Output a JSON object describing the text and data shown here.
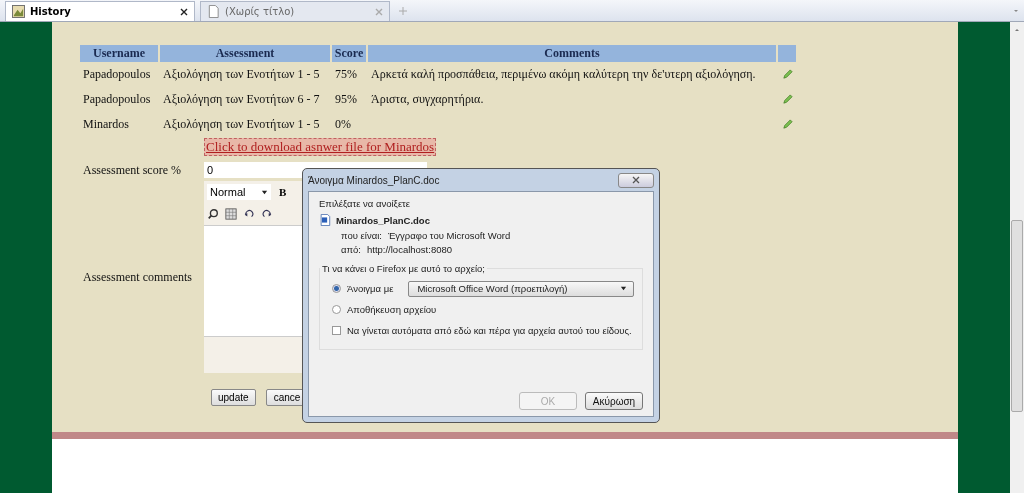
{
  "tabs": [
    {
      "label": "History",
      "selected": true,
      "kind": "history"
    },
    {
      "label": "(Χωρίς τίτλο)",
      "selected": false,
      "kind": "page"
    }
  ],
  "table": {
    "columns": [
      "Username",
      "Assessment",
      "Score",
      "Comments"
    ],
    "rows": [
      {
        "username": "Papadopoulos",
        "assessment": "Αξιολόγηση των Ενοτήτων 1 - 5",
        "score": "75%",
        "comments": "Αρκετά καλή προσπάθεια, περιμένω ακόμη καλύτερη την δε'υτερη αξιολόγηση."
      },
      {
        "username": "Papadopoulos",
        "assessment": "Αξιολόγηση των Ενοτήτων 6 - 7",
        "score": "95%",
        "comments": "Άριστα, συγχαρητήρια."
      },
      {
        "username": "Minardos",
        "assessment": "Αξιολόγηση των Ενοτήτων 1 - 5",
        "score": "0%"
      }
    ]
  },
  "download_link": "Click to download asnwer file for Minardos",
  "form": {
    "score_label": "Assessment score %",
    "score_value": "0",
    "comments_label": "Assessment comments",
    "editor": {
      "format": "Normal",
      "bold": "B"
    },
    "buttons": [
      {
        "label": "update"
      },
      {
        "label": "cance"
      }
    ]
  },
  "dialog": {
    "title": "Άνοιγμα Minardos_PlanC.doc",
    "prompt": "Επιλέξατε να ανοίξετε",
    "filename": "Minardos_PlanC.doc",
    "type_label": "που είναι:",
    "type_value": "Έγγραφο του Microsoft Word",
    "from_label": "από:",
    "from_value": "http://localhost:8080",
    "question": "Τι να κάνει ο Firefox  με αυτό το αρχείο;",
    "options": [
      {
        "label": "Άνοιγμα με",
        "selected": true
      },
      {
        "label": "Αποθήκευση αρχείου",
        "selected": false
      }
    ],
    "application": "Microsoft Office Word (προεπιλογή)",
    "remember": {
      "label": "Να γίνεται αυτόματα από εδώ και πέρα για αρχεία αυτού του είδους.",
      "checked": false
    },
    "ok": {
      "label": "OK",
      "disabled": true
    },
    "cancel": "Ακύρωση"
  }
}
